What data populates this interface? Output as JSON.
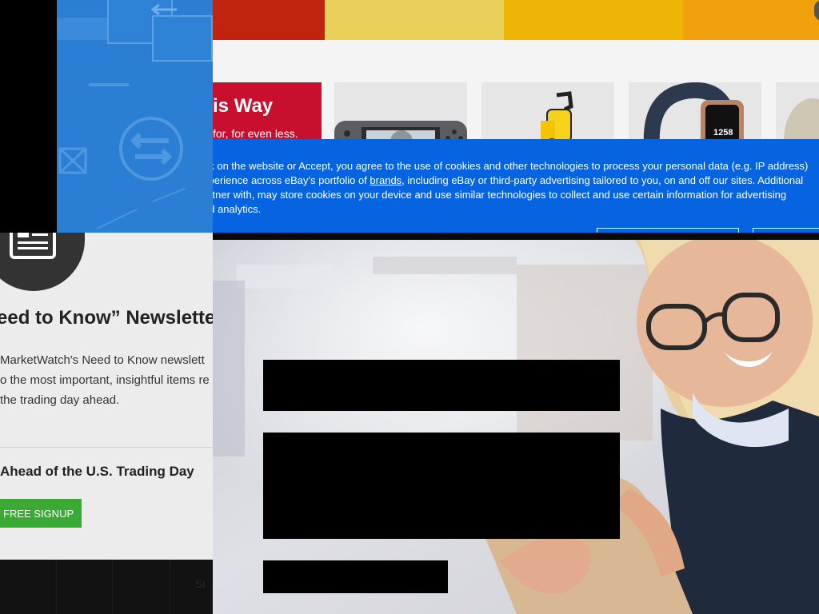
{
  "newsletter": {
    "title": "eed to Know” Newslette",
    "description_lines": [
      "MarketWatch's Need to Know newslett",
      "o the most important, insightful items re",
      "the trading day ahead."
    ],
    "section_heading": "Ahead of the U.S. Trading Day",
    "signup_label": "FREE SIGNUP",
    "footer_fragment": "Si"
  },
  "ebay": {
    "stripe_colors": [
      "#c1240e",
      "#e8d05a",
      "#efb506",
      "#f0a10b"
    ],
    "promo_headline": "is Way",
    "promo_subline": "for, for even less.",
    "fitness_band_time": "1258",
    "cookie": {
      "line1": "nk on the website or Accept, you agree to the use of cookies and other technologies to process your personal data (e.g. IP address)",
      "line2_before": "xperience across eBay's portfolio of ",
      "line2_link": "brands",
      "line2_after": ", including eBay or third-party advertising tailored to you, on and off our sites. Additional",
      "line3": "artner with, may store cookies on your device and use similar technologies to collect and use certain information for advertising",
      "line4": "nd analytics."
    }
  },
  "colors": {
    "cookie_blue": "#0764e0",
    "signup_green": "#3aaa35",
    "promo_red": "#c8102e",
    "tile_blue": "#2a7fd4"
  }
}
